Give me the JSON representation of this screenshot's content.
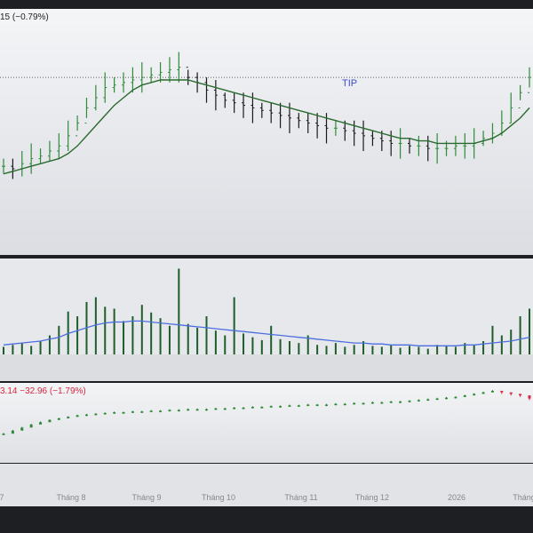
{
  "price_legend": "15 (−0.79%)",
  "symbol": "TIP",
  "index_legend": "3.14  −32.96 (−1.79%)",
  "colors": {
    "up": "#2e8b3a",
    "down": "#1a1a1a",
    "ma": "#2a6b2f",
    "volume_ma": "#4b6fe0",
    "volume_bar": "#1f5e2a",
    "index_up": "#2e8b3a",
    "index_down": "#d7263d",
    "symbol_text": "#3b4ec8"
  },
  "chart_data": [
    {
      "type": "candlestick",
      "name": "price",
      "x_labels": [
        "7",
        "Tháng 8",
        "Tháng 9",
        "Tháng 10",
        "Tháng 11",
        "Tháng 12",
        "2026",
        "Tháng"
      ],
      "values": [
        35,
        34,
        36,
        38,
        39,
        41,
        43,
        47,
        52,
        58,
        62,
        66,
        67,
        68,
        69,
        70,
        71,
        72,
        73,
        74,
        70,
        68,
        65,
        63,
        61,
        60,
        59,
        58,
        57,
        56,
        55,
        54,
        53,
        52,
        51,
        50,
        50,
        49,
        48,
        47,
        46,
        45,
        44,
        44,
        43,
        43,
        42,
        42,
        42,
        43,
        43,
        44,
        46,
        48,
        52,
        58,
        64,
        70
      ],
      "ma": [
        32,
        33,
        34,
        35,
        36,
        37,
        38,
        40,
        43,
        47,
        51,
        55,
        59,
        62,
        65,
        67,
        68,
        69,
        69,
        69,
        69,
        68,
        67,
        66,
        65,
        64,
        63,
        62,
        61,
        60,
        59,
        58,
        57,
        56,
        55,
        54,
        53,
        52,
        51,
        50,
        49,
        48,
        47,
        46,
        46,
        45,
        45,
        44,
        44,
        44,
        44,
        44,
        45,
        46,
        48,
        51,
        54,
        58
      ],
      "reference_line": 70
    },
    {
      "type": "bar",
      "name": "volume",
      "values": [
        8,
        10,
        12,
        9,
        14,
        20,
        30,
        45,
        40,
        55,
        60,
        50,
        48,
        35,
        40,
        52,
        44,
        38,
        30,
        90,
        32,
        28,
        40,
        25,
        20,
        60,
        22,
        18,
        15,
        30,
        16,
        14,
        12,
        20,
        10,
        9,
        12,
        8,
        10,
        14,
        9,
        8,
        10,
        7,
        9,
        8,
        6,
        10,
        9,
        8,
        12,
        10,
        14,
        30,
        20,
        26,
        40,
        48
      ],
      "ma": [
        10,
        11,
        12,
        13,
        14,
        16,
        18,
        22,
        25,
        28,
        31,
        33,
        34,
        34,
        35,
        35,
        34,
        33,
        32,
        31,
        30,
        29,
        28,
        27,
        26,
        25,
        24,
        23,
        22,
        21,
        20,
        19,
        18,
        17,
        16,
        15,
        14,
        13,
        12,
        12,
        11,
        11,
        10,
        10,
        10,
        9,
        9,
        9,
        9,
        9,
        10,
        10,
        11,
        12,
        13,
        14,
        16,
        18
      ]
    },
    {
      "type": "candlestick",
      "name": "index",
      "values": [
        20,
        24,
        28,
        32,
        35,
        38,
        40,
        42,
        44,
        45,
        46,
        47,
        48,
        48,
        49,
        49,
        50,
        50,
        51,
        51,
        52,
        52,
        52,
        53,
        53,
        54,
        54,
        55,
        55,
        56,
        56,
        57,
        57,
        58,
        58,
        58,
        59,
        59,
        60,
        60,
        61,
        61,
        62,
        62,
        63,
        64,
        65,
        66,
        67,
        68,
        70,
        72,
        74,
        76,
        74,
        72,
        70,
        66
      ]
    }
  ]
}
